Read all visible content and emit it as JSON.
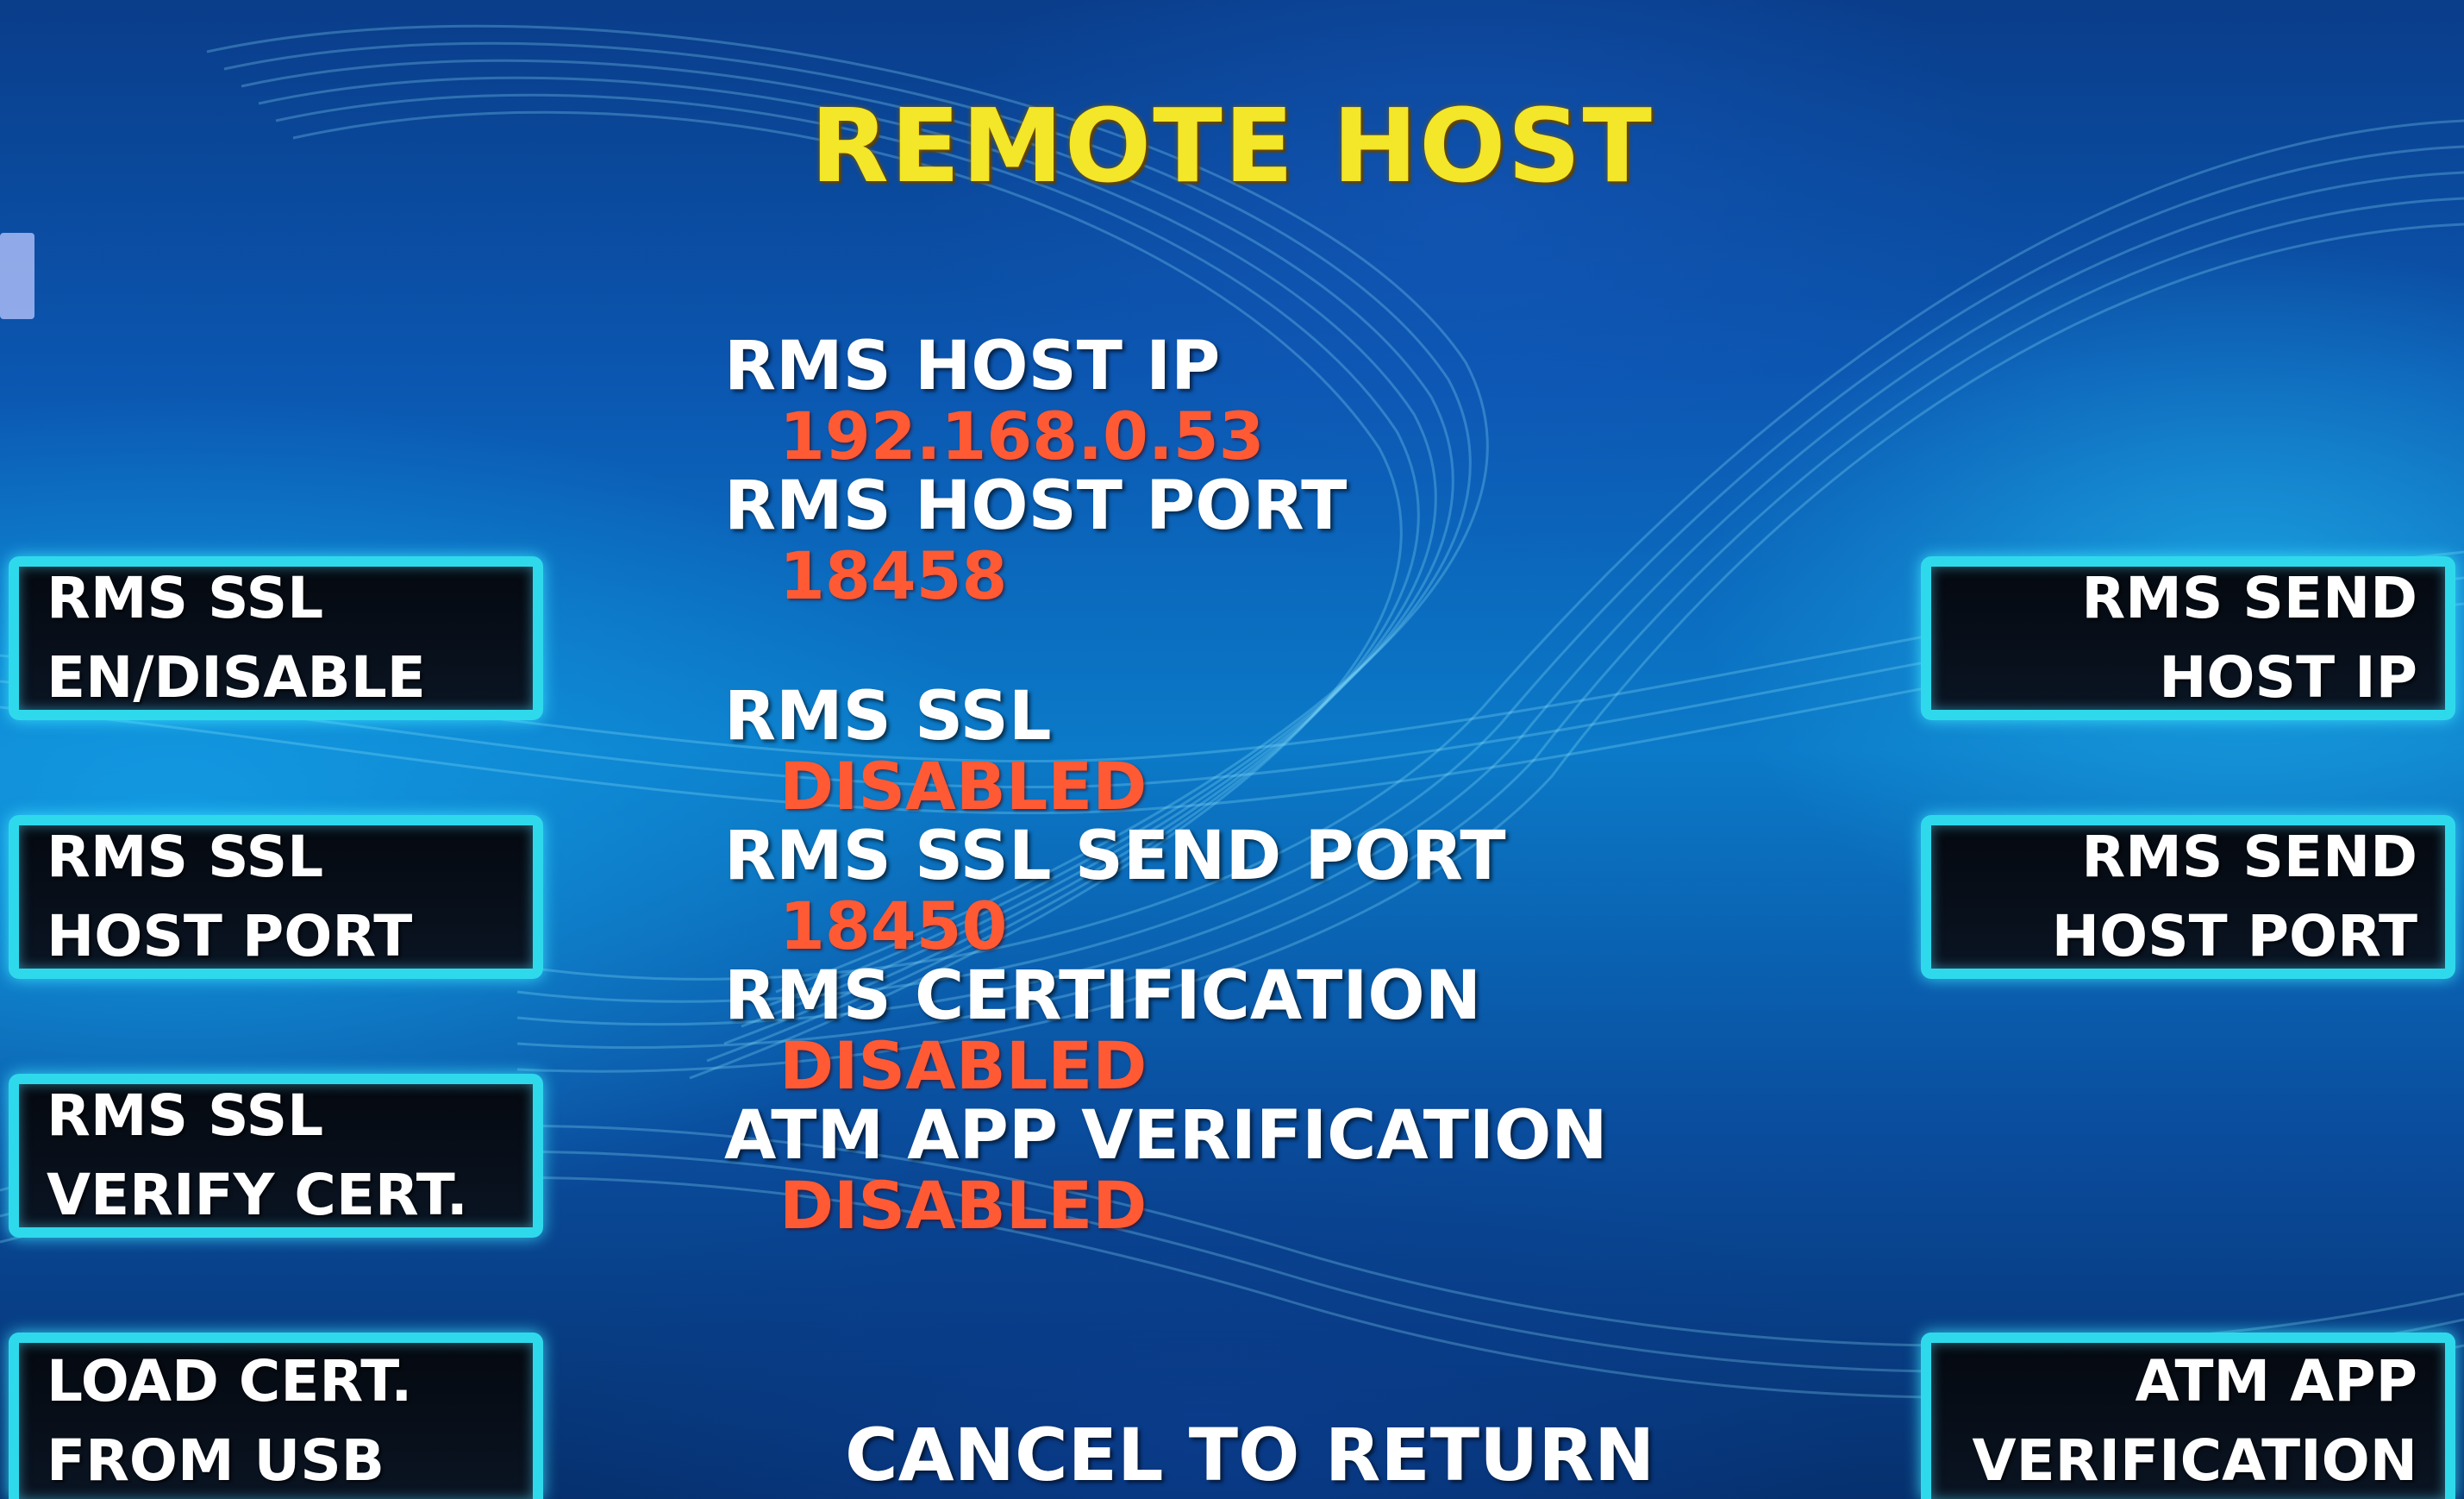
{
  "screen": {
    "title": "REMOTE HOST",
    "footer": "CANCEL TO RETURN"
  },
  "info": [
    {
      "label": "RMS HOST IP",
      "value": "192.168.0.53"
    },
    {
      "label": "RMS HOST PORT",
      "value": "18458"
    },
    {
      "label": "RMS SSL",
      "value": "DISABLED"
    },
    {
      "label": "RMS SSL SEND PORT",
      "value": "18450"
    },
    {
      "label": "RMS CERTIFICATION",
      "value": "DISABLED"
    },
    {
      "label": "ATM APP VERIFICATION",
      "value": "DISABLED"
    }
  ],
  "left_keys": [
    {
      "line1": "RMS SSL",
      "line2": "EN/DISABLE"
    },
    {
      "line1": "RMS SSL",
      "line2": "HOST PORT"
    },
    {
      "line1": "RMS SSL",
      "line2": "VERIFY CERT."
    },
    {
      "line1": "LOAD CERT.",
      "line2": "FROM USB"
    }
  ],
  "right_keys": [
    {
      "line1": "RMS SEND",
      "line2": "HOST IP"
    },
    {
      "line1": "RMS SEND",
      "line2": "HOST PORT"
    },
    {
      "line1": "ATM APP",
      "line2": "VERIFICATION"
    }
  ],
  "colors": {
    "title": "#f4e628",
    "label": "#ffffff",
    "value": "#ff5a33",
    "key_border": "#2fd9ec",
    "key_fill": "#050910"
  }
}
